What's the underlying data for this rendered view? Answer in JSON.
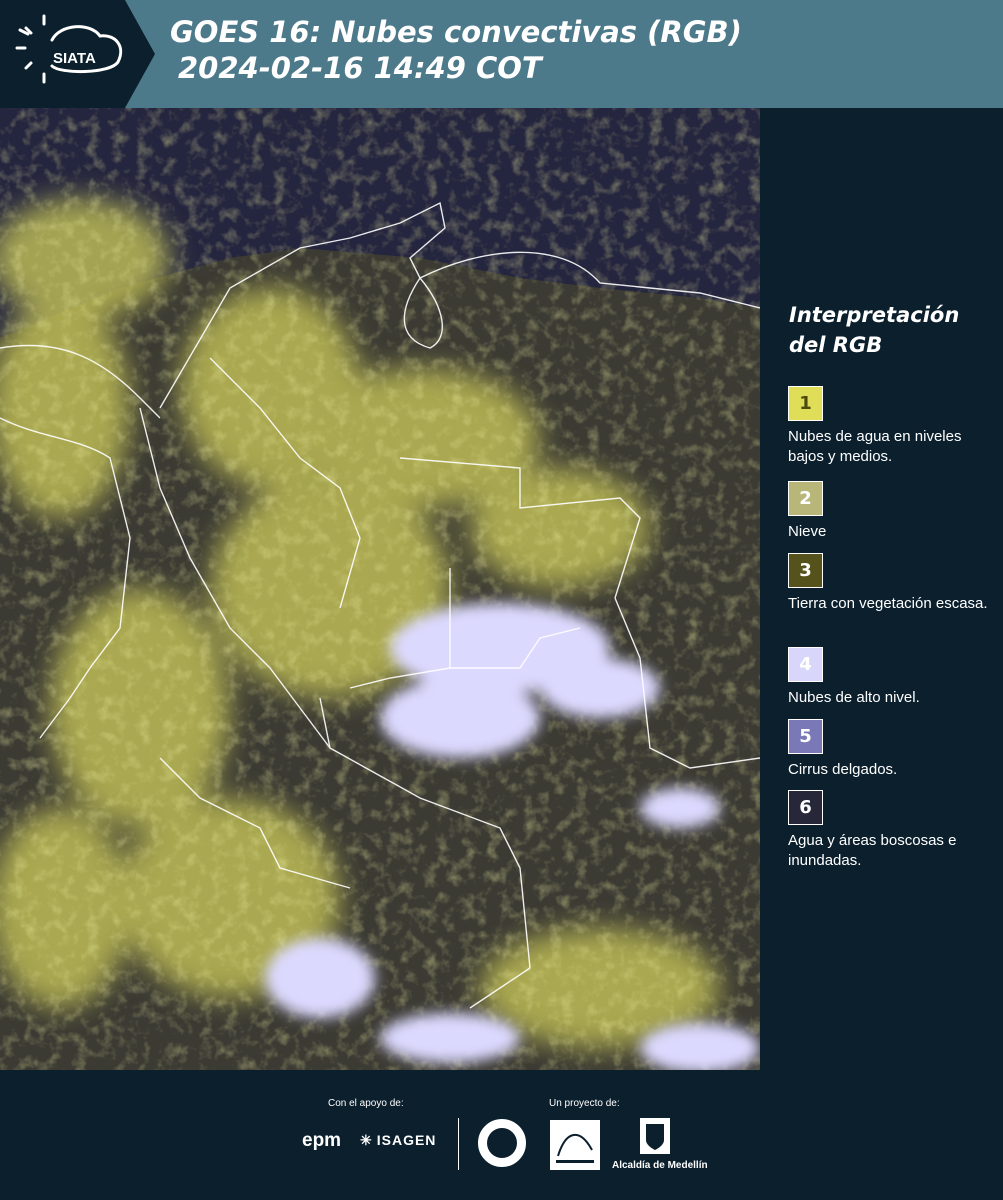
{
  "header": {
    "logo_text": "SIATA",
    "title_line1": "GOES 16: Nubes convectivas (RGB)",
    "title_line2": "2024-02-16 14:49 COT",
    "background": "#4d7a8a",
    "logo_band_color": "#0b1f2d"
  },
  "map": {
    "description_colors": {
      "ocean": "#24253e",
      "low_clouds": "#d9d96a",
      "high_clouds": "#d7d4ff",
      "borders": "#ffffff"
    }
  },
  "legend": {
    "title_line1": "Interpretación",
    "title_line2": "del RGB",
    "items": [
      {
        "number": "1",
        "text": "Nubes de agua en niveles bajos y medios.",
        "color": "#e0dd58",
        "number_color": "#4d4a10"
      },
      {
        "number": "2",
        "text": "Nieve",
        "color": "#b9b679",
        "number_color": "#ffffff"
      },
      {
        "number": "3",
        "text": "Tierra con vegetación escasa.",
        "color": "#55521c",
        "number_color": "#ffffff"
      },
      {
        "number": "4",
        "text": "Nubes de alto nivel.",
        "color": "#d9d6fb",
        "number_color": "#ffffff"
      },
      {
        "number": "5",
        "text": "Cirrus delgados.",
        "color": "#7a78b6",
        "number_color": "#ffffff"
      },
      {
        "number": "6",
        "text": "Agua y áreas boscosas e inundadas.",
        "color": "#262738",
        "number_color": "#ffffff"
      }
    ]
  },
  "footer": {
    "support_label": "Con el apoyo de:",
    "project_label": "Un proyecto de:",
    "sponsor_epm": "epm",
    "sponsor_isagen": "ISAGEN",
    "alcaldia": "Alcaldía de Medellín"
  }
}
